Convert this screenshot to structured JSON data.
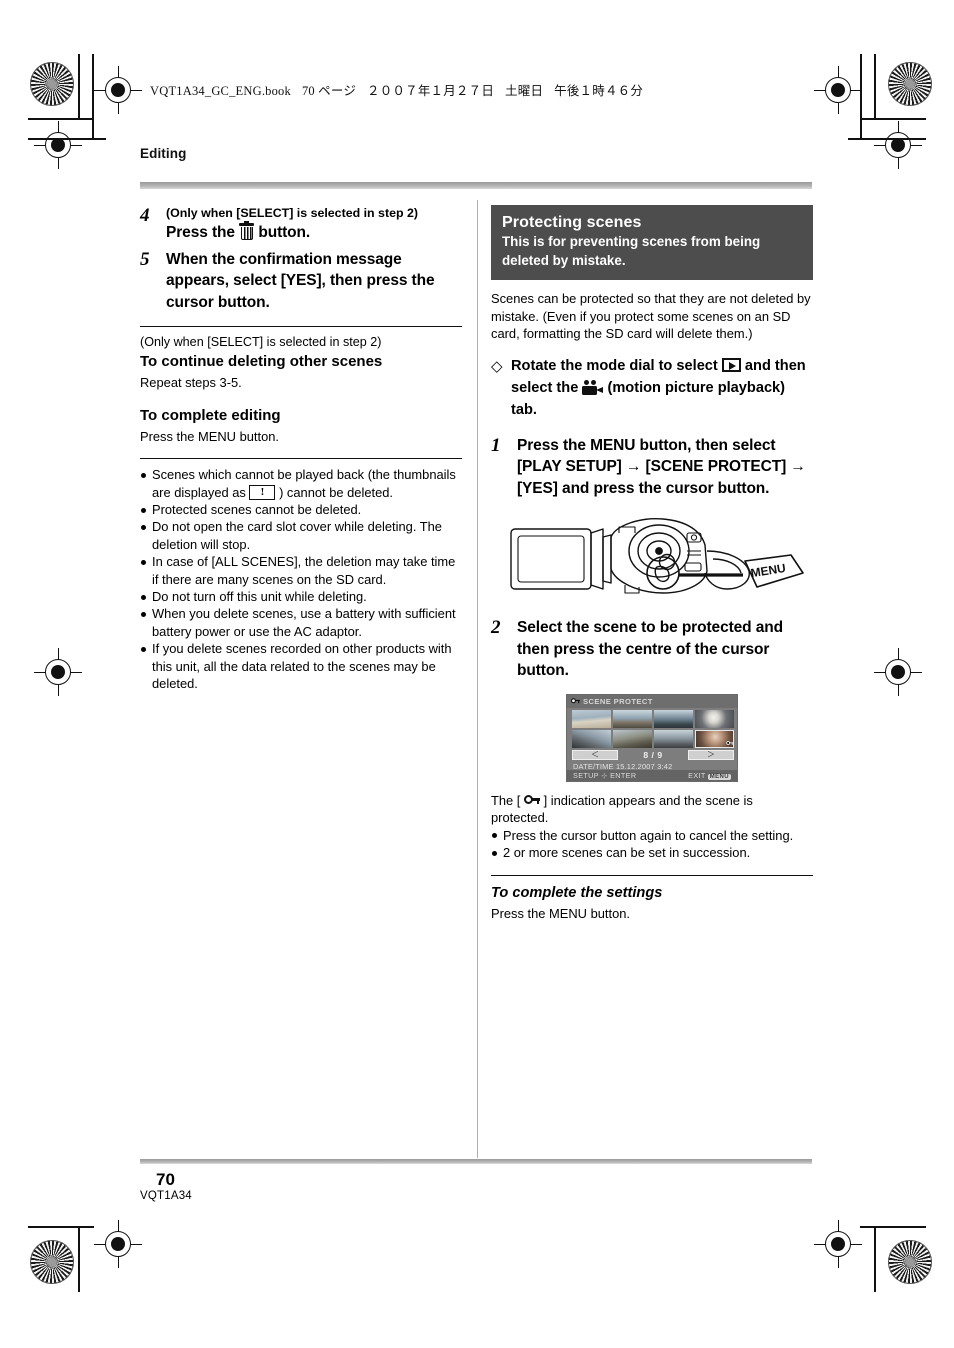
{
  "print_marks": {
    "present": true
  },
  "file_header": {
    "filename": "VQT1A34_GC_ENG.book",
    "page_label": "70 ページ",
    "date": "２００７年１月２７日",
    "weekday": "土曜日",
    "time": "午後１時４６分"
  },
  "chapter": "Editing",
  "footer": {
    "page_number": "70",
    "doc_code": "VQT1A34"
  },
  "left_column": {
    "steps": [
      {
        "number": "4",
        "condition": "(Only when [SELECT] is selected in step 2)",
        "text_before_icon": "Press the",
        "icon": "trash-icon",
        "text_after_icon": "button."
      },
      {
        "number": "5",
        "condition": "",
        "text": "When the confirmation message appears, select [YES], then press the cursor button."
      }
    ],
    "section_a": {
      "condition": "(Only when [SELECT] is selected in step 2)",
      "heading": "To continue deleting other scenes",
      "body": "Repeat steps 3-5."
    },
    "section_b": {
      "heading": "To complete editing",
      "body": "Press the MENU button."
    },
    "notes": [
      {
        "before": "Scenes which cannot be played back (the thumbnails are displayed as",
        "icon": "warning-thumbnail-icon",
        "after": ") cannot be deleted."
      },
      {
        "text": "Protected scenes cannot be deleted."
      },
      {
        "text": "Do not open the card slot cover while deleting. The deletion will stop."
      },
      {
        "text": "In case of [ALL SCENES], the deletion may take time if there are many scenes on the SD card."
      },
      {
        "text": "Do not turn off this unit while deleting."
      },
      {
        "text": "When you delete scenes, use a battery with sufficient battery power or use the AC adaptor."
      },
      {
        "text": "If you delete scenes recorded on other products with this unit, all the data related to the scenes may be deleted."
      }
    ]
  },
  "right_column": {
    "title_box": {
      "title": "Protecting scenes",
      "subtitle": "This is for preventing scenes from being deleted by mistake."
    },
    "intro": "Scenes can be protected so that they are not deleted by mistake. (Even if you protect some scenes on an SD card, formatting the SD card will delete them.)",
    "diamond_note": {
      "marker": "◇",
      "part1": "Rotate the mode dial to select",
      "icon1": "playback-mode-icon",
      "part2": "and then select the",
      "icon2": "motion-picture-icon",
      "part3": "(motion picture playback) tab."
    },
    "steps": [
      {
        "number": "1",
        "text": "Press the MENU button, then select [PLAY SETUP] → [SCENE PROTECT] → [YES] and press the cursor button."
      },
      {
        "number": "2",
        "text": "Select the scene to be protected and then press the centre of the cursor button."
      }
    ],
    "camera_figure": {
      "callout_label": "MENU",
      "description": "camcorder-with-menu-button"
    },
    "lcd_screen": {
      "title": "SCENE PROTECT",
      "title_icon": "key-icon",
      "counter": "8 / 9",
      "prev_label": "＜",
      "next_label": "＞",
      "datetime_label": "DATE/TIME",
      "datetime_value": "15.12.2007",
      "time_value": "3:42",
      "setup_label": "SETUP",
      "enter_label": "ENTER",
      "exit_label": "EXIT",
      "exit_button": "MENU",
      "thumbnail_count": 8,
      "selected_thumbnail_index": 8
    },
    "after_figure": {
      "before": "The [",
      "icon": "key-icon",
      "after": "] indication appears and the scene is protected."
    },
    "notes": [
      {
        "text": "Press the cursor button again to cancel the setting."
      },
      {
        "text": "2 or more scenes can be set in succession."
      }
    ],
    "section_c": {
      "heading": "To complete the settings",
      "body": "Press the MENU button."
    }
  }
}
